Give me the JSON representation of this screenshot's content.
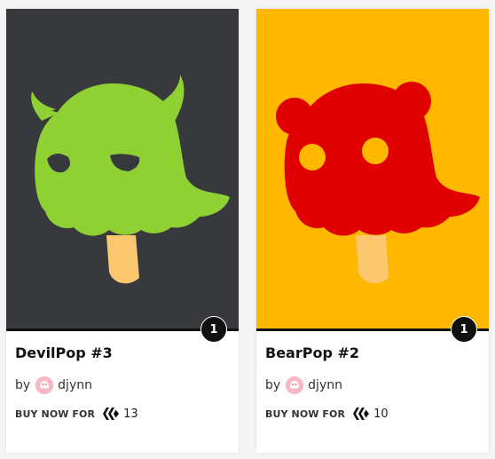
{
  "cards": [
    {
      "title": "DevilPop #3",
      "count": "1",
      "by_label": "by",
      "author": "djynn",
      "buy_label": "BUY NOW FOR",
      "price": "13",
      "background_color": "#38393d",
      "character_color": "#8fd132",
      "icon": "devil-pop-character"
    },
    {
      "title": "BearPop #2",
      "count": "1",
      "by_label": "by",
      "author": "djynn",
      "buy_label": "BUY NOW FOR",
      "price": "10",
      "background_color": "#ffb700",
      "character_color": "#e00000",
      "icon": "bear-pop-character"
    }
  ],
  "colors": {
    "stick": "#fbc76f",
    "badge": "#111111",
    "avatar": "#f7b8c4"
  }
}
